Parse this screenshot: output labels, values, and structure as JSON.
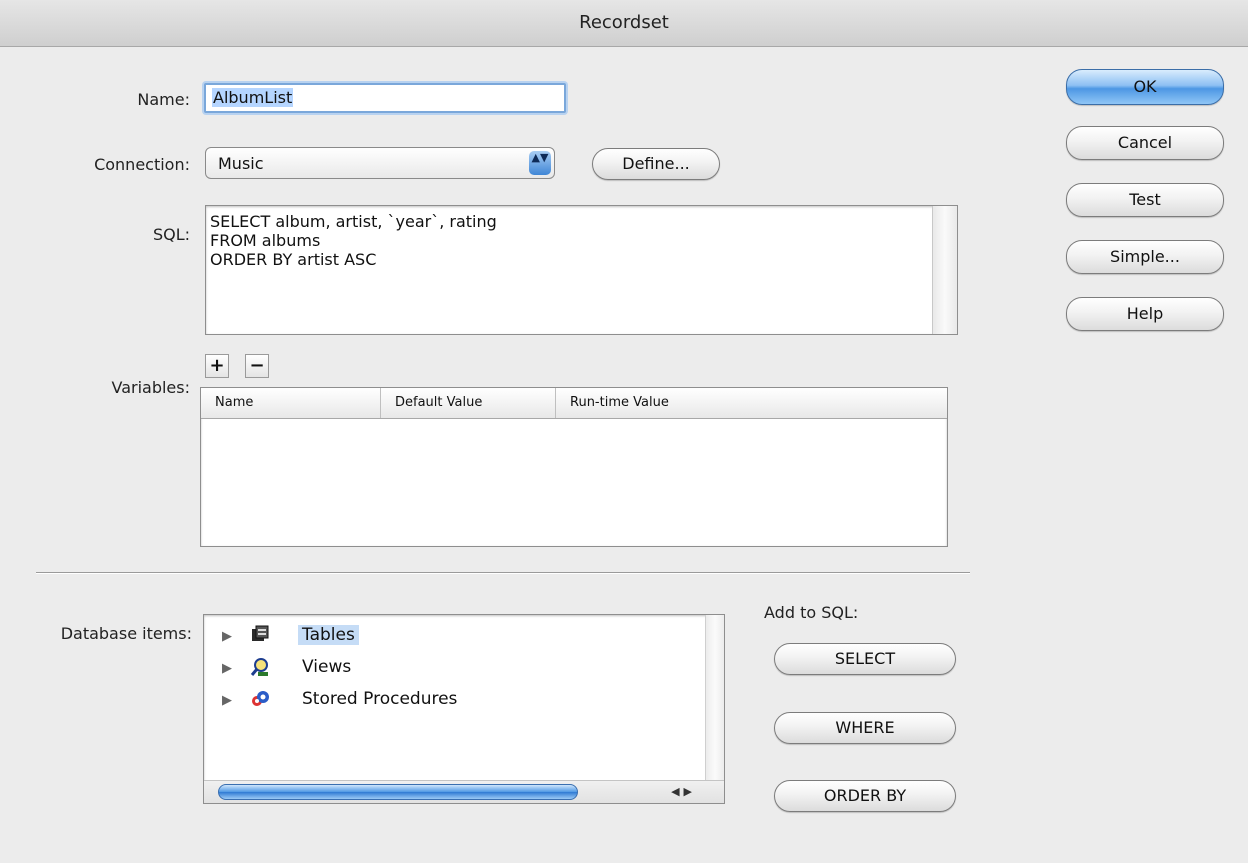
{
  "window": {
    "title": "Recordset"
  },
  "labels": {
    "name": "Name:",
    "connection": "Connection:",
    "sql": "SQL:",
    "variables": "Variables:",
    "database_items": "Database items:",
    "add_to_sql": "Add to SQL:"
  },
  "name_field": {
    "value": "AlbumList"
  },
  "connection": {
    "selected": "Music",
    "arrow_glyph": "▲▼"
  },
  "define_button": "Define...",
  "sql_text": "SELECT album, artist, `year`, rating\nFROM albums\nORDER BY artist ASC",
  "variables": {
    "add": "+",
    "remove": "−",
    "columns": [
      "Name",
      "Default Value",
      "Run-time Value"
    ]
  },
  "side_buttons": [
    "OK",
    "Cancel",
    "Test",
    "Simple...",
    "Help"
  ],
  "database_items": [
    {
      "label": "Tables",
      "icon": "table-icon",
      "selected": true
    },
    {
      "label": "Views",
      "icon": "view-icon",
      "selected": false
    },
    {
      "label": "Stored Procedures",
      "icon": "stored-procedure-icon",
      "selected": false
    }
  ],
  "add_to_sql_buttons": [
    "SELECT",
    "WHERE",
    "ORDER BY"
  ],
  "colors": {
    "accent": "#4d97e4",
    "selection": "#c5dcf6"
  }
}
